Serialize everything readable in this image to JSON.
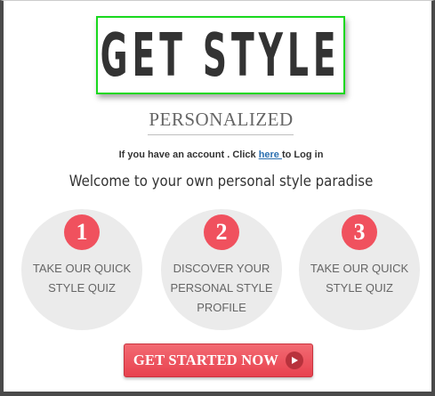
{
  "logo": {
    "text": "GET STYLE"
  },
  "subtitle": "PERSONALIZED",
  "login": {
    "prefix": "If you have an account . Click ",
    "link_text": "here ",
    "suffix": "to Log in"
  },
  "welcome": "Welcome to your own personal style paradise",
  "steps": [
    {
      "number": "1",
      "text_line1": "TAKE OUR QUICK",
      "text_line2": "STYLE QUIZ",
      "text_line3": ""
    },
    {
      "number": "2",
      "text_line1": "DISCOVER YOUR",
      "text_line2": "PERSONAL STYLE",
      "text_line3": "PROFILE"
    },
    {
      "number": "3",
      "text_line1": "TAKE OUR QUICK",
      "text_line2": "STYLE QUIZ",
      "text_line3": ""
    }
  ],
  "cta": {
    "label": "GET STARTED NOW",
    "icon": "play-icon"
  },
  "colors": {
    "logo_border": "#19d81e",
    "accent": "#f0515e",
    "circle_bg": "#ebebeb",
    "link": "#2b6fb0",
    "frame": "#4a4a4a"
  }
}
